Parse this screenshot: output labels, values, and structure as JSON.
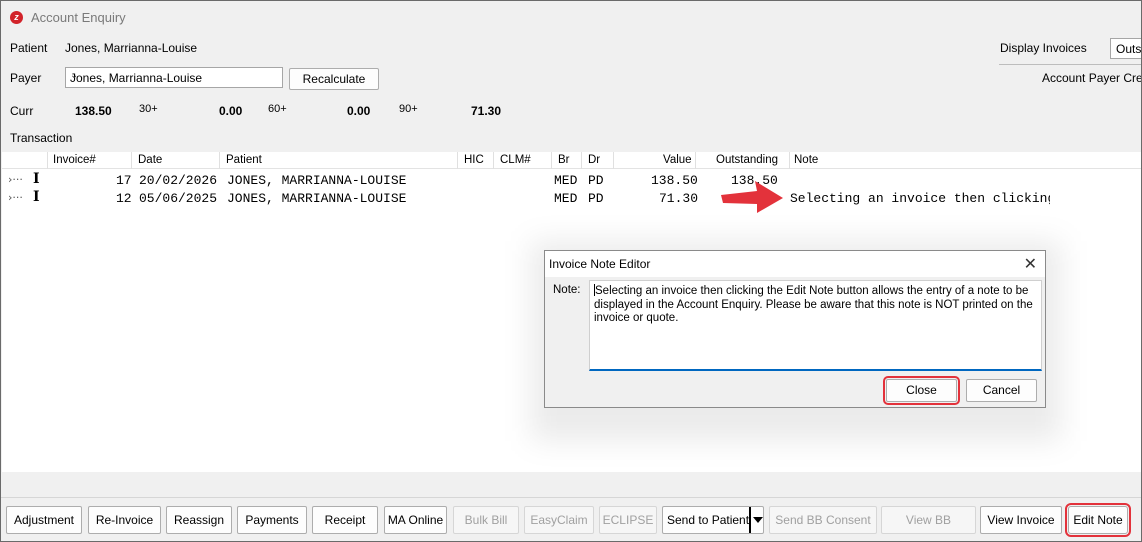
{
  "window": {
    "title": "Account Enquiry"
  },
  "header": {
    "patient_label": "Patient",
    "patient_value": "Jones, Marrianna-Louise",
    "payer_label": "Payer",
    "payer_value": "Jones, Marrianna-Louise",
    "recalculate_label": "Recalculate",
    "display_invoices_label": "Display Invoices",
    "display_invoices_value": "Outs",
    "account_payer_label": "Account Payer Cred",
    "curr_label": "Curr",
    "curr_value": "138.50",
    "age30_label": "30+",
    "age30_value": "0.00",
    "age60_label": "60+",
    "age60_value": "0.00",
    "age90_label": "90+",
    "age90_value": "71.30",
    "transaction_label": "Transaction"
  },
  "grid": {
    "columns": [
      "Invoice#",
      "Date",
      "Patient",
      "HIC",
      "CLM#",
      "Br",
      "Dr",
      "Value",
      "Outstanding",
      "Note"
    ],
    "rows": [
      {
        "invoice": "17",
        "date": "20/02/2026",
        "patient": "JONES, MARRIANNA-LOUISE",
        "br": "MED",
        "dr": "PD",
        "value": "138.50",
        "outstanding": "138.50",
        "note": ""
      },
      {
        "invoice": "12",
        "date": "05/06/2025",
        "patient": "JONES, MARRIANNA-LOUISE",
        "br": "MED",
        "dr": "PD",
        "value": "71.30",
        "outstanding": "",
        "note": "Selecting an invoice then clicking the Edit"
      }
    ]
  },
  "dialog": {
    "title": "Invoice Note Editor",
    "note_label": "Note:",
    "note_text": "Selecting an invoice then clicking the Edit Note button allows the entry of a note to be displayed in the Account Enquiry. Please be aware that this note is NOT printed on the invoice or quote.",
    "close_label": "Close",
    "cancel_label": "Cancel"
  },
  "toolbar": {
    "adjustment": "Adjustment",
    "reinvoice": "Re-Invoice",
    "reassign": "Reassign",
    "payments": "Payments",
    "receipt": "Receipt",
    "ma_online": "MA Online",
    "bulk_bill": "Bulk Bill",
    "easyclaim": "EasyClaim",
    "eclipse": "ECLIPSE",
    "send_to_patient": "Send to Patient",
    "send_bb_consent": "Send BB Consent",
    "view_bb_consent": "View BB Consent",
    "view_invoice": "View Invoice",
    "edit_note": "Edit Note"
  },
  "colors": {
    "highlight": "#e3323b",
    "arrow": "#e3323b",
    "focus": "#0067c0"
  }
}
